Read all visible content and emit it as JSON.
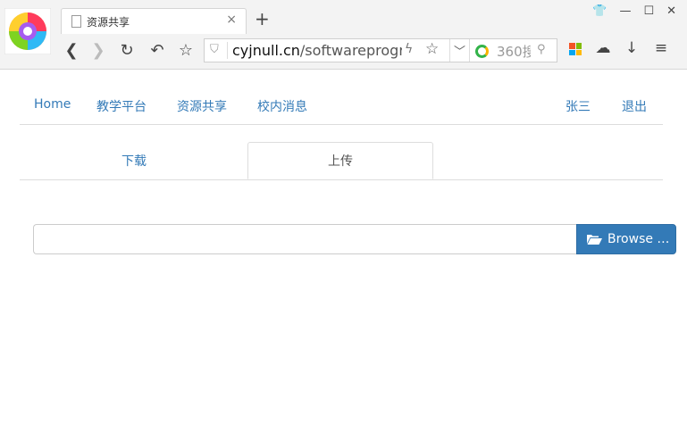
{
  "browser": {
    "tab_title": "资源共享",
    "tab_close": "×",
    "new_tab": "+",
    "url_domain": "cyjnull.cn",
    "url_path": "/softwareprogram",
    "search_placeholder": "360搜",
    "window_buttons": [
      "👕",
      "—",
      "☐",
      "✕"
    ]
  },
  "nav": {
    "home": "Home",
    "teaching": "教学平台",
    "sharing": "资源共享",
    "news": "校内消息",
    "user": "张三",
    "logout": "退出"
  },
  "tabs": {
    "download": "下载",
    "upload": "上传",
    "active": "upload"
  },
  "upload": {
    "file_value": "",
    "browse_label": "Browse …"
  },
  "colors": {
    "link": "#337ab7",
    "primary_button": "#337ab7"
  }
}
